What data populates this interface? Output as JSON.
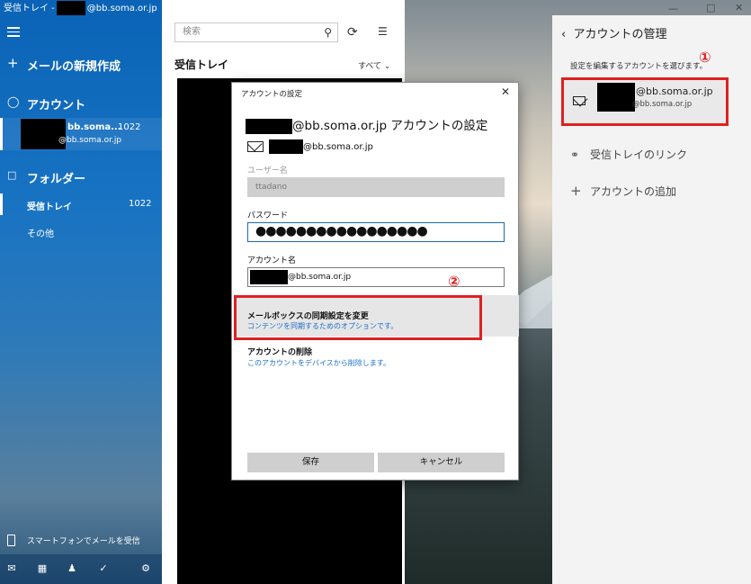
{
  "window": {
    "title_prefix": "受信トレイ -",
    "title_suffix": "@bb.soma.or.jp"
  },
  "nav": {
    "new_mail": "メールの新規作成",
    "account_header": "アカウント",
    "account": {
      "email": "@bb.soma.or.jp",
      "name_prefix": "bb.soma...",
      "count": "1022"
    },
    "folder_header": "フォルダー",
    "inbox": {
      "label": "受信トレイ",
      "count": "1022"
    },
    "other": "その他",
    "phone": "スマートフォンでメールを受信"
  },
  "list": {
    "search_placeholder": "検索",
    "title": "受信トレイ",
    "filter": "すべて"
  },
  "panel": {
    "title": "アカウントの管理",
    "subtitle": "設定を編集するアカウントを選びます。",
    "account_email": "@bb.soma.or.jp",
    "account_email_sub": "@bb.soma.or.jp",
    "inbox_link": "受信トレイのリンク",
    "add_account": "アカウントの追加",
    "marker1": "①"
  },
  "dialog": {
    "title": "アカウントの設定",
    "heading_suffix": "@bb.soma.or.jp アカウントの設定",
    "address": "@bb.soma.or.jp",
    "username_label": "ユーザー名",
    "username_value": "ttadano",
    "password_label": "パスワード",
    "password_value": "●●●●●●●●●●●●●●●●●",
    "account_name_label": "アカウント名",
    "account_name_value": "@bb.soma.or.jp",
    "marker2": "②",
    "sync_title": "メールボックスの同期設定を変更",
    "sync_sub": "コンテンツを同期するためのオプションです。",
    "delete_title": "アカウントの削除",
    "delete_sub": "このアカウントをデバイスから削除します。",
    "save": "保存",
    "cancel": "キャンセル"
  },
  "colors": {
    "accent": "#1873c3",
    "highlight": "#e02020",
    "link": "#1a6fc9"
  }
}
